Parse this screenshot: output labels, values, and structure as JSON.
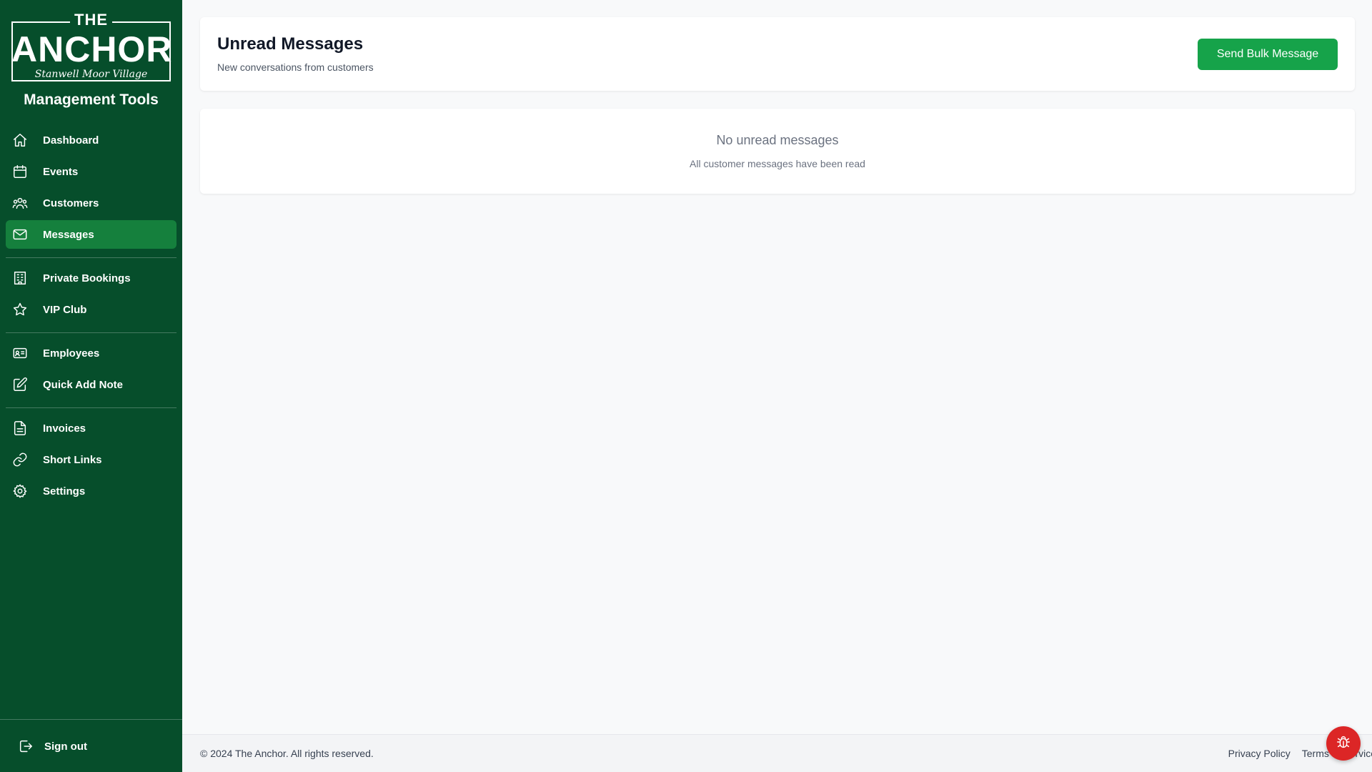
{
  "logo": {
    "the": "THE",
    "anchor": "ANCHOR",
    "tagline": "Stanwell Moor Village"
  },
  "sidebar": {
    "title": "Management Tools",
    "items": [
      {
        "label": "Dashboard",
        "icon": "home-icon"
      },
      {
        "label": "Events",
        "icon": "calendar-icon"
      },
      {
        "label": "Customers",
        "icon": "users-icon"
      },
      {
        "label": "Messages",
        "icon": "envelope-icon",
        "active": true
      },
      {
        "label": "Private Bookings",
        "icon": "building-icon"
      },
      {
        "label": "VIP Club",
        "icon": "star-icon"
      },
      {
        "label": "Employees",
        "icon": "id-card-icon"
      },
      {
        "label": "Quick Add Note",
        "icon": "pencil-square-icon"
      },
      {
        "label": "Invoices",
        "icon": "document-icon"
      },
      {
        "label": "Short Links",
        "icon": "link-icon"
      },
      {
        "label": "Settings",
        "icon": "gear-icon"
      }
    ],
    "signout": {
      "label": "Sign out",
      "icon": "sign-out-icon"
    }
  },
  "header": {
    "title": "Unread Messages",
    "subtitle": "New conversations from customers",
    "bulk_button": "Send Bulk Message"
  },
  "empty_state": {
    "title": "No unread messages",
    "subtitle": "All customer messages have been read"
  },
  "footer": {
    "copyright": "© 2024 The Anchor. All rights reserved.",
    "links": [
      "Privacy Policy",
      "Terms of Service"
    ]
  },
  "colors": {
    "sidebar_bg": "#064e2b",
    "active_item": "#15803d",
    "primary_button": "#16a34a",
    "bug_button": "#dc2626"
  },
  "bug_report": {
    "icon": "bug-icon"
  }
}
